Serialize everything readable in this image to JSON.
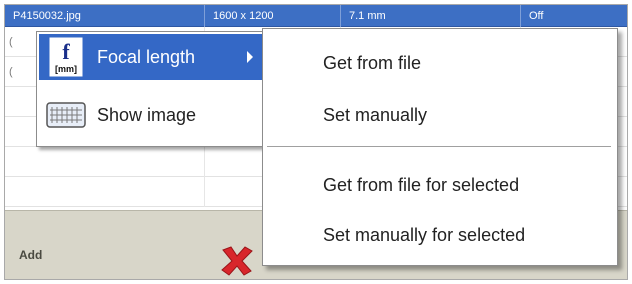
{
  "table": {
    "header": [
      "P4150032.jpg",
      "1600 x 1200",
      "7.1 mm",
      "Off"
    ],
    "rows": [
      [
        "(",
        "",
        "",
        ""
      ],
      [
        "(",
        "",
        "",
        ""
      ],
      [
        "",
        "",
        "",
        ""
      ],
      [
        "",
        "",
        "",
        ""
      ],
      [
        "",
        "",
        "",
        ""
      ],
      [
        "",
        "",
        "",
        ""
      ]
    ]
  },
  "bottom_bar": {
    "add_label": "Add",
    "remove_icon": "red-x-icon"
  },
  "context_menu": {
    "items": [
      {
        "label": "Focal length",
        "icon": "focal-length-icon",
        "icon_text": "f",
        "icon_subtext": "[mm]",
        "highlighted": true,
        "has_submenu": true
      },
      {
        "label": "Show image",
        "icon": "image-grid-icon",
        "highlighted": false,
        "has_submenu": false
      }
    ]
  },
  "submenu": {
    "items": [
      {
        "label": "Get from file"
      },
      {
        "label": "Set manually"
      },
      {
        "label": "Get from file for selected"
      },
      {
        "label": "Set manually for selected"
      }
    ]
  },
  "colors": {
    "highlight": "#3468c6",
    "header_blue": "#3d6fc4",
    "bar_bg": "#d8d6c9",
    "remove_red": "#d8262b"
  }
}
